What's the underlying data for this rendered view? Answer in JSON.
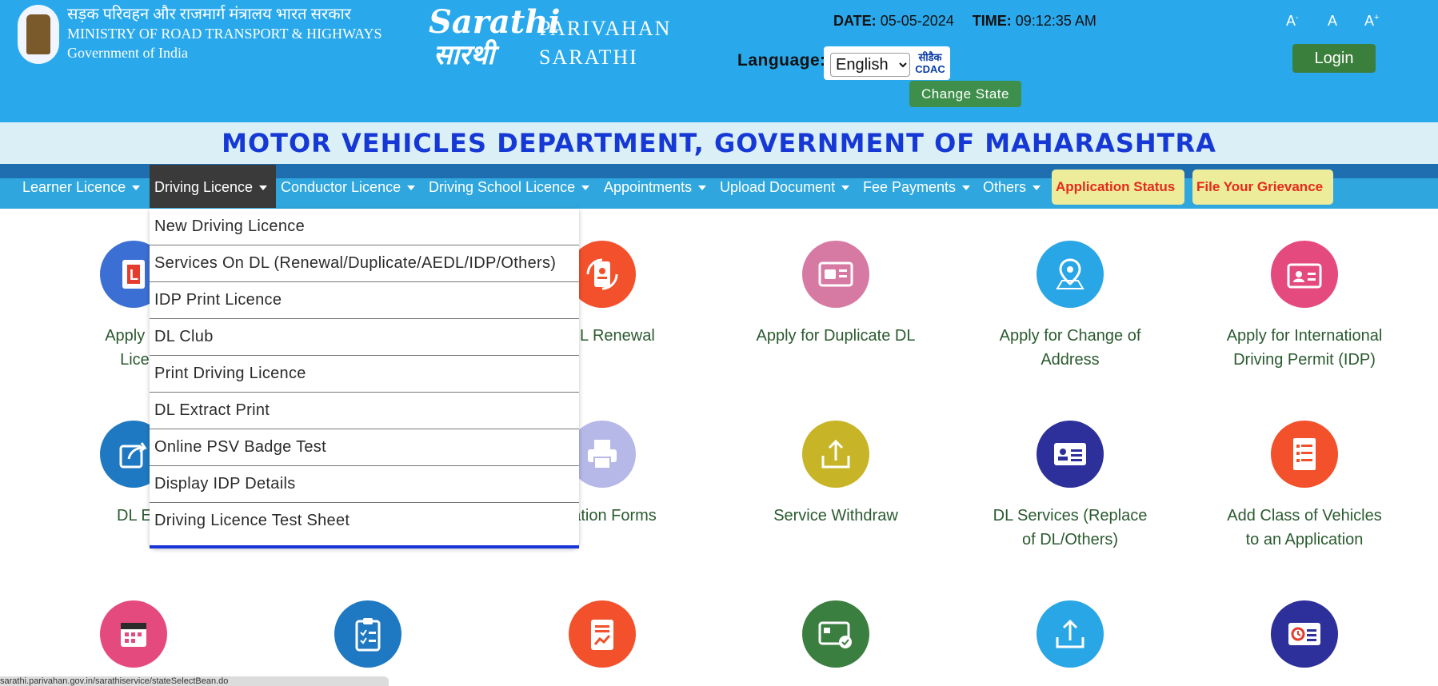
{
  "header": {
    "ministry_hindi": "सड़क परिवहन और राजमार्ग मंत्रालय भारत सरकार",
    "ministry_english": "MINISTRY OF ROAD TRANSPORT & HIGHWAYS",
    "government": "Government of India",
    "logo_latin": "Sarathi",
    "logo_devanagari": "सारथी",
    "brand_line1": "PARIVAHAN",
    "brand_line2": "SARATHI",
    "date_label": "DATE:",
    "date_value": "05-05-2024",
    "time_label": "TIME:",
    "time_value": "09:12:35 AM",
    "language_label": "Language:",
    "language_selected": "English",
    "cdac_line1": "सीडैक",
    "cdac_line2": "CDAC",
    "change_state": "Change State",
    "font_decrease": "A",
    "font_decrease_sup": "-",
    "font_normal": "A",
    "font_increase": "A",
    "font_increase_sup": "+",
    "login": "Login"
  },
  "banner": {
    "title": "MOTOR VEHICLES DEPARTMENT, GOVERNMENT OF MAHARASHTRA"
  },
  "nav": {
    "items": [
      {
        "label": "Learner Licence"
      },
      {
        "label": "Driving Licence"
      },
      {
        "label": "Conductor Licence"
      },
      {
        "label": "Driving School Licence"
      },
      {
        "label": "Appointments"
      },
      {
        "label": "Upload Document"
      },
      {
        "label": "Fee Payments"
      },
      {
        "label": "Others"
      }
    ],
    "application_status": "Application Status",
    "grievance": "File Your Grievance"
  },
  "dropdown": {
    "items": [
      "New Driving Licence",
      "Services On DL (Renewal/Duplicate/AEDL/IDP/Others)",
      "IDP Print Licence",
      "DL Club",
      "Print Driving Licence",
      "DL Extract Print",
      "Online PSV Badge Test",
      "Display IDP Details",
      "Driving Licence Test Sheet"
    ]
  },
  "cards": {
    "row1": [
      {
        "label": "Apply for L",
        "label2": "Licenc",
        "icon": "learner-licence-icon",
        "color": "#3b6fd4"
      },
      {
        "label": "or DL Renewal",
        "label2": "",
        "icon": "dl-renewal-icon",
        "color": "#f2512b"
      },
      {
        "label": "Apply for Duplicate DL",
        "label2": "",
        "icon": "duplicate-dl-icon",
        "color": "#d77aa3"
      },
      {
        "label": "Apply for Change of",
        "label2": "Address",
        "icon": "location-pin-icon",
        "color": "#29a6e6"
      },
      {
        "label": "Apply for International",
        "label2": "Driving Permit (IDP)",
        "icon": "id-card-icon",
        "color": "#e54a7e"
      }
    ],
    "row2": [
      {
        "label": "DL Extr",
        "label2": "",
        "icon": "share-icon",
        "color": "#1f79c2"
      },
      {
        "label": "plication Forms",
        "label2": "",
        "icon": "printer-icon",
        "color": "#b6b9e8"
      },
      {
        "label": "Service Withdraw",
        "label2": "",
        "icon": "upload-box-icon",
        "color": "#c8b427"
      },
      {
        "label": "DL Services (Replace",
        "label2": "of DL/Others)",
        "icon": "dl-card-icon",
        "color": "#2d2f9a"
      },
      {
        "label": "Add Class of Vehicles",
        "label2": "to an Application",
        "icon": "checklist-icon",
        "color": "#f2512b"
      }
    ],
    "row3": [
      {
        "icon": "calendar-icon",
        "color": "#e54a7e"
      },
      {
        "icon": "clipboard-check-icon",
        "color": "#1f79c2"
      },
      {
        "icon": "report-icon",
        "color": "#f2512b"
      },
      {
        "icon": "payment-card-icon",
        "color": "#3a7f3f"
      },
      {
        "icon": "upload-icon",
        "color": "#29a6e6"
      },
      {
        "icon": "time-card-icon",
        "color": "#2d2f9a"
      }
    ]
  },
  "status_bar": {
    "text": "sarathi.parivahan.gov.in/sarathiservice/stateSelectBean.do"
  }
}
